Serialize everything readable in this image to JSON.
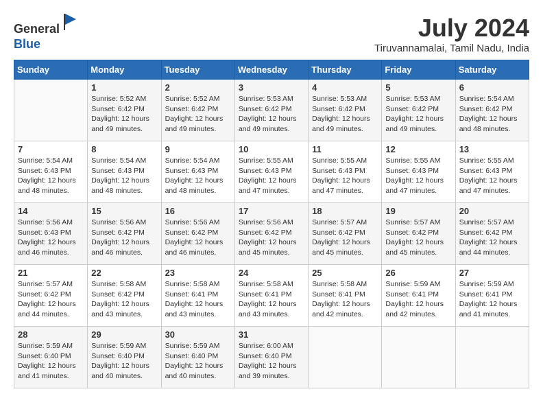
{
  "header": {
    "logo_general": "General",
    "logo_blue": "Blue",
    "title": "July 2024",
    "location": "Tiruvannamalai, Tamil Nadu, India"
  },
  "weekdays": [
    "Sunday",
    "Monday",
    "Tuesday",
    "Wednesday",
    "Thursday",
    "Friday",
    "Saturday"
  ],
  "weeks": [
    [
      {
        "day": "",
        "info": ""
      },
      {
        "day": "1",
        "info": "Sunrise: 5:52 AM\nSunset: 6:42 PM\nDaylight: 12 hours\nand 49 minutes."
      },
      {
        "day": "2",
        "info": "Sunrise: 5:52 AM\nSunset: 6:42 PM\nDaylight: 12 hours\nand 49 minutes."
      },
      {
        "day": "3",
        "info": "Sunrise: 5:53 AM\nSunset: 6:42 PM\nDaylight: 12 hours\nand 49 minutes."
      },
      {
        "day": "4",
        "info": "Sunrise: 5:53 AM\nSunset: 6:42 PM\nDaylight: 12 hours\nand 49 minutes."
      },
      {
        "day": "5",
        "info": "Sunrise: 5:53 AM\nSunset: 6:42 PM\nDaylight: 12 hours\nand 49 minutes."
      },
      {
        "day": "6",
        "info": "Sunrise: 5:54 AM\nSunset: 6:42 PM\nDaylight: 12 hours\nand 48 minutes."
      }
    ],
    [
      {
        "day": "7",
        "info": "Sunrise: 5:54 AM\nSunset: 6:43 PM\nDaylight: 12 hours\nand 48 minutes."
      },
      {
        "day": "8",
        "info": "Sunrise: 5:54 AM\nSunset: 6:43 PM\nDaylight: 12 hours\nand 48 minutes."
      },
      {
        "day": "9",
        "info": "Sunrise: 5:54 AM\nSunset: 6:43 PM\nDaylight: 12 hours\nand 48 minutes."
      },
      {
        "day": "10",
        "info": "Sunrise: 5:55 AM\nSunset: 6:43 PM\nDaylight: 12 hours\nand 47 minutes."
      },
      {
        "day": "11",
        "info": "Sunrise: 5:55 AM\nSunset: 6:43 PM\nDaylight: 12 hours\nand 47 minutes."
      },
      {
        "day": "12",
        "info": "Sunrise: 5:55 AM\nSunset: 6:43 PM\nDaylight: 12 hours\nand 47 minutes."
      },
      {
        "day": "13",
        "info": "Sunrise: 5:55 AM\nSunset: 6:43 PM\nDaylight: 12 hours\nand 47 minutes."
      }
    ],
    [
      {
        "day": "14",
        "info": "Sunrise: 5:56 AM\nSunset: 6:43 PM\nDaylight: 12 hours\nand 46 minutes."
      },
      {
        "day": "15",
        "info": "Sunrise: 5:56 AM\nSunset: 6:42 PM\nDaylight: 12 hours\nand 46 minutes."
      },
      {
        "day": "16",
        "info": "Sunrise: 5:56 AM\nSunset: 6:42 PM\nDaylight: 12 hours\nand 46 minutes."
      },
      {
        "day": "17",
        "info": "Sunrise: 5:56 AM\nSunset: 6:42 PM\nDaylight: 12 hours\nand 45 minutes."
      },
      {
        "day": "18",
        "info": "Sunrise: 5:57 AM\nSunset: 6:42 PM\nDaylight: 12 hours\nand 45 minutes."
      },
      {
        "day": "19",
        "info": "Sunrise: 5:57 AM\nSunset: 6:42 PM\nDaylight: 12 hours\nand 45 minutes."
      },
      {
        "day": "20",
        "info": "Sunrise: 5:57 AM\nSunset: 6:42 PM\nDaylight: 12 hours\nand 44 minutes."
      }
    ],
    [
      {
        "day": "21",
        "info": "Sunrise: 5:57 AM\nSunset: 6:42 PM\nDaylight: 12 hours\nand 44 minutes."
      },
      {
        "day": "22",
        "info": "Sunrise: 5:58 AM\nSunset: 6:42 PM\nDaylight: 12 hours\nand 43 minutes."
      },
      {
        "day": "23",
        "info": "Sunrise: 5:58 AM\nSunset: 6:41 PM\nDaylight: 12 hours\nand 43 minutes."
      },
      {
        "day": "24",
        "info": "Sunrise: 5:58 AM\nSunset: 6:41 PM\nDaylight: 12 hours\nand 43 minutes."
      },
      {
        "day": "25",
        "info": "Sunrise: 5:58 AM\nSunset: 6:41 PM\nDaylight: 12 hours\nand 42 minutes."
      },
      {
        "day": "26",
        "info": "Sunrise: 5:59 AM\nSunset: 6:41 PM\nDaylight: 12 hours\nand 42 minutes."
      },
      {
        "day": "27",
        "info": "Sunrise: 5:59 AM\nSunset: 6:41 PM\nDaylight: 12 hours\nand 41 minutes."
      }
    ],
    [
      {
        "day": "28",
        "info": "Sunrise: 5:59 AM\nSunset: 6:40 PM\nDaylight: 12 hours\nand 41 minutes."
      },
      {
        "day": "29",
        "info": "Sunrise: 5:59 AM\nSunset: 6:40 PM\nDaylight: 12 hours\nand 40 minutes."
      },
      {
        "day": "30",
        "info": "Sunrise: 5:59 AM\nSunset: 6:40 PM\nDaylight: 12 hours\nand 40 minutes."
      },
      {
        "day": "31",
        "info": "Sunrise: 6:00 AM\nSunset: 6:40 PM\nDaylight: 12 hours\nand 39 minutes."
      },
      {
        "day": "",
        "info": ""
      },
      {
        "day": "",
        "info": ""
      },
      {
        "day": "",
        "info": ""
      }
    ]
  ]
}
